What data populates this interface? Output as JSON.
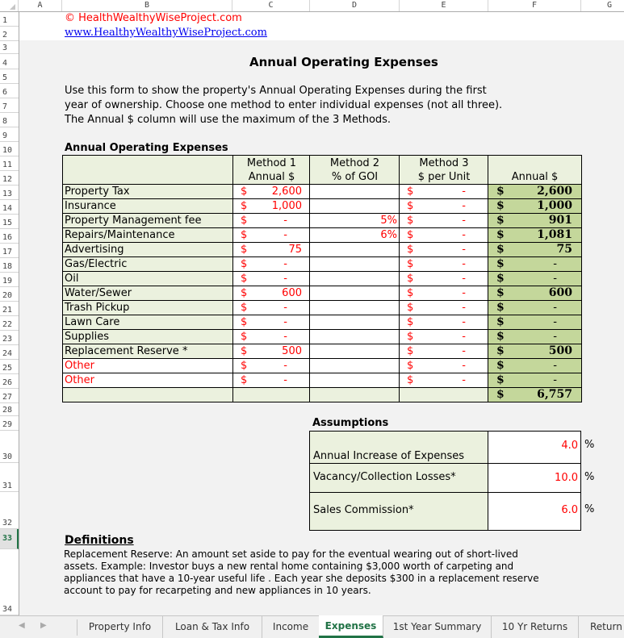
{
  "columns": [
    "A",
    "B",
    "C",
    "D",
    "E",
    "F",
    "G"
  ],
  "rows": [
    "1",
    "2",
    "3",
    "4",
    "5",
    "6",
    "7",
    "8",
    "9",
    "10",
    "11",
    "12",
    "13",
    "14",
    "15",
    "16",
    "17",
    "18",
    "19",
    "20",
    "21",
    "22",
    "23",
    "24",
    "25",
    "26",
    "27",
    "28",
    "29",
    "30",
    "31",
    "32",
    "33",
    "34"
  ],
  "selected_row": "33",
  "header": {
    "copyright": "© HealthWealthyWiseProject.com",
    "website": "www.HealthyWealthyWiseProject.com",
    "title": "Annual Operating Expenses"
  },
  "intro": [
    "Use this form to show the property's Annual Operating Expenses during the first",
    "year of ownership.  Choose one method to enter individual expenses (not all three).",
    "The Annual $ column will use the maximum of the 3 Methods."
  ],
  "expenses_table": {
    "section_title": "Annual Operating Expenses",
    "columns": [
      {
        "line1": "Method 1",
        "line2": "Annual $"
      },
      {
        "line1": "Method 2",
        "line2": "% of GOI"
      },
      {
        "line1": "Method 3",
        "line2": "$ per Unit"
      },
      {
        "line1": "",
        "line2": "Annual $"
      }
    ],
    "currency_symbol": "$",
    "rows": [
      {
        "label": "Property Tax",
        "method1": "2,600",
        "method2": "",
        "method3": "-",
        "annual": "2,600",
        "label_red": false
      },
      {
        "label": "Insurance",
        "method1": "1,000",
        "method2": "",
        "method3": "-",
        "annual": "1,000",
        "label_red": false
      },
      {
        "label": "Property Management fee",
        "method1": "-",
        "method2": "5%",
        "method3": "-",
        "annual": "901",
        "label_red": false
      },
      {
        "label": "Repairs/Maintenance",
        "method1": "-",
        "method2": "6%",
        "method3": "-",
        "annual": "1,081",
        "label_red": false
      },
      {
        "label": "Advertising",
        "method1": "75",
        "method2": "",
        "method3": "-",
        "annual": "75",
        "label_red": false
      },
      {
        "label": "Gas/Electric",
        "method1": "-",
        "method2": "",
        "method3": "-",
        "annual": "-",
        "label_red": false
      },
      {
        "label": "Oil",
        "method1": "-",
        "method2": "",
        "method3": "-",
        "annual": "-",
        "label_red": false
      },
      {
        "label": "Water/Sewer",
        "method1": "600",
        "method2": "",
        "method3": "-",
        "annual": "600",
        "label_red": false
      },
      {
        "label": "Trash Pickup",
        "method1": "-",
        "method2": "",
        "method3": "-",
        "annual": "-",
        "label_red": false
      },
      {
        "label": "Lawn Care",
        "method1": "-",
        "method2": "",
        "method3": "-",
        "annual": "-",
        "label_red": false
      },
      {
        "label": "Supplies",
        "method1": "-",
        "method2": "",
        "method3": "-",
        "annual": "-",
        "label_red": false
      },
      {
        "label": "Replacement Reserve *",
        "method1": "500",
        "method2": "",
        "method3": "-",
        "annual": "500",
        "label_red": false
      },
      {
        "label": "Other",
        "method1": "-",
        "method2": "",
        "method3": "-",
        "annual": "-",
        "label_red": true
      },
      {
        "label": "Other",
        "method1": "-",
        "method2": "",
        "method3": "-",
        "annual": "-",
        "label_red": true
      }
    ],
    "total": "6,757"
  },
  "assumptions": {
    "title": "Assumptions",
    "items": [
      {
        "label": "Annual Increase of Expenses",
        "value": "4.0",
        "unit": "%"
      },
      {
        "label": "Vacancy/Collection Losses*",
        "value": "10.0",
        "unit": "%"
      },
      {
        "label": "Sales Commission*",
        "value": "6.0",
        "unit": "%"
      }
    ]
  },
  "definitions": {
    "title": "Definitions",
    "lines": [
      "Replacement Reserve: An amount set aside to pay for the eventual wearing out of short-lived",
      "assets.  Example: Investor buys a new rental home containing $3,000 worth of carpeting and",
      "appliances that have a 10-year useful life . Each year she deposits $300 in a replacement reserve",
      "account to pay for recarpeting and new appliances in 10 years."
    ]
  },
  "sheet_tabs": {
    "prev_icon": "◀",
    "next_icon": "▶",
    "tabs": [
      "Property Info",
      "Loan & Tax Info",
      "Income",
      "Expenses",
      "1st Year Summary",
      "10 Yr Returns",
      "Return"
    ],
    "active": "Expenses"
  },
  "colors": {
    "header_fill": "#ebf1de",
    "annual_fill": "#c4d79b",
    "input_red": "#ff0000",
    "excel_green": "#217346",
    "link_blue": "#0000ee"
  }
}
